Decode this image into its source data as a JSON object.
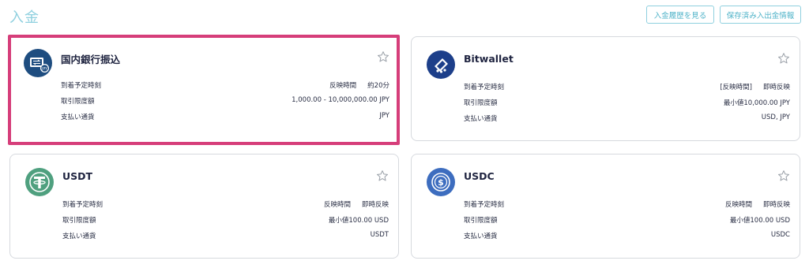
{
  "page": {
    "title": "入金"
  },
  "toolbar": {
    "history_label": "入金履歴を見る",
    "saved_label": "保存済み入出金情報"
  },
  "cards": [
    {
      "title": "国内銀行振込",
      "logo_color": "#1e4d80",
      "icon": "bank-transfer-icon",
      "rows": [
        {
          "label": "到着予定時刻",
          "value": [
            "反映時間",
            "約20分"
          ]
        },
        {
          "label": "取引限度額",
          "value": [
            "1,000.00 - 10,000,000.00 JPY"
          ]
        },
        {
          "label": "支払い通貨",
          "value": [
            "JPY"
          ]
        }
      ]
    },
    {
      "title": "Bitwallet",
      "logo_color": "#1d3f8a",
      "icon": "bitwallet-icon",
      "rows": [
        {
          "label": "到着予定時刻",
          "value": [
            "[反映時間]",
            "即時反映"
          ]
        },
        {
          "label": "取引限度額",
          "value": [
            "最小値10,000.00 JPY"
          ]
        },
        {
          "label": "支払い通貨",
          "value": [
            "USD, JPY"
          ]
        }
      ]
    },
    {
      "title": "USDT",
      "logo_color": "#4fa07f",
      "icon": "tether-icon",
      "rows": [
        {
          "label": "到着予定時刻",
          "value": [
            "反映時間",
            "即時反映"
          ]
        },
        {
          "label": "取引限度額",
          "value": [
            "最小値100.00 USD"
          ]
        },
        {
          "label": "支払い通貨",
          "value": [
            "USDT"
          ]
        }
      ]
    },
    {
      "title": "USDC",
      "logo_color": "#3d6dbf",
      "icon": "usdc-icon",
      "rows": [
        {
          "label": "到着予定時刻",
          "value": [
            "反映時間",
            "即時反映"
          ]
        },
        {
          "label": "取引限度額",
          "value": [
            "最小値100.00 USD"
          ]
        },
        {
          "label": "支払い通貨",
          "value": [
            "USDC"
          ]
        }
      ]
    }
  ]
}
